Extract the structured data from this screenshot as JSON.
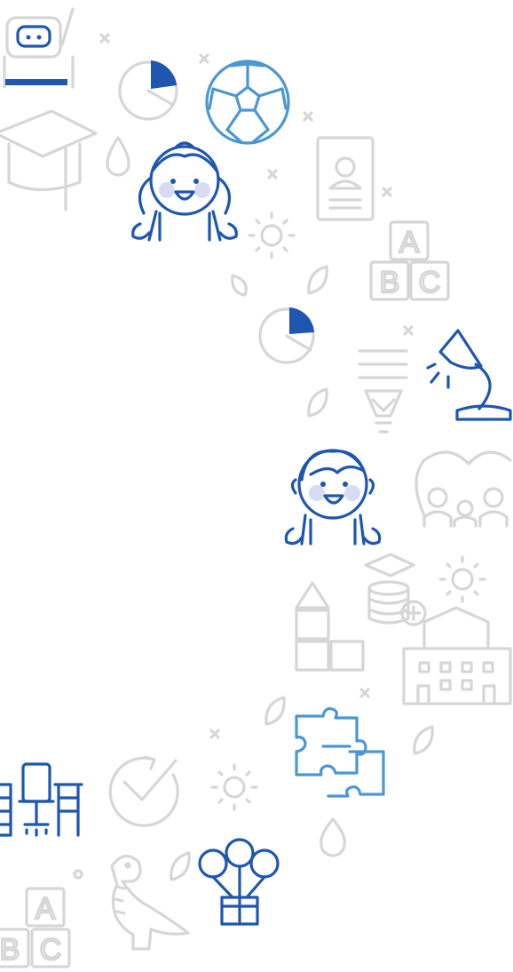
{
  "illustration": {
    "palette": {
      "grey": "#d6d6d6",
      "blue": "#1e56b0",
      "light_blue": "#4a97d4",
      "cheek": "#d7dbf3"
    },
    "block_letters_top": [
      "A",
      "B",
      "C"
    ],
    "block_letters_bottom": [
      "A",
      "B",
      "C"
    ],
    "icons": [
      "robot-icon",
      "pie-chart-icon",
      "soccer-ball-icon",
      "graduation-cap-icon",
      "drop-icon",
      "girl-icon",
      "id-card-icon",
      "sun-icon",
      "leaf-icon",
      "abc-blocks-icon",
      "desk-lamp-icon",
      "light-bulb-icon",
      "boy-icon",
      "family-icon",
      "coin-stack-icon",
      "toy-blocks-icon",
      "school-building-icon",
      "puzzle-icon",
      "desk-icon",
      "checkmark-icon",
      "balloons-gift-icon",
      "dinosaur-icon"
    ]
  }
}
